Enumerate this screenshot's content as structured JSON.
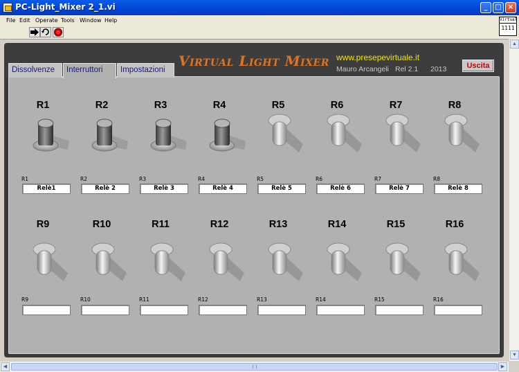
{
  "window": {
    "title": "PC-Light_Mixer 2_1.vi",
    "minimize": "_",
    "maximize": "□",
    "close": "×"
  },
  "menu": [
    "File",
    "Edit",
    "Operate",
    "Tools",
    "Window",
    "Help"
  ],
  "toolbar": {
    "run_icon": "run-arrow-icon",
    "continuous_icon": "run-continuous-icon",
    "abort_icon": "abort-icon"
  },
  "vi_icon_text": "Virtual\n1111",
  "tabs": [
    "Dissolvenze",
    "Interruttori",
    "Impostazioni"
  ],
  "active_tab": 1,
  "header": {
    "title": "Virtual Light Mixer",
    "url": "www.presepevirtuale.it",
    "author": "Mauro Arcangeli",
    "release": "Rel 2.1",
    "year": "2013",
    "exit_button": "Uscita"
  },
  "colors": {
    "title": "#e0731f",
    "url": "#f2e600",
    "exit": "#c8000f"
  },
  "switches": [
    {
      "label": "R1",
      "state": "on",
      "caption": "R1",
      "name": "Relè1"
    },
    {
      "label": "R2",
      "state": "on",
      "caption": "R2",
      "name": "Relè 2"
    },
    {
      "label": "R3",
      "state": "on",
      "caption": "R3",
      "name": "Relè 3"
    },
    {
      "label": "R4",
      "state": "on",
      "caption": "R4",
      "name": "Relè 4"
    },
    {
      "label": "R5",
      "state": "off",
      "caption": "R5",
      "name": "Relè 5"
    },
    {
      "label": "R6",
      "state": "off",
      "caption": "R6",
      "name": "Relè 6"
    },
    {
      "label": "R7",
      "state": "off",
      "caption": "R7",
      "name": "Relè 7"
    },
    {
      "label": "R8",
      "state": "off",
      "caption": "R8",
      "name": "Relè 8"
    },
    {
      "label": "R9",
      "state": "off",
      "caption": "R9",
      "name": ""
    },
    {
      "label": "R10",
      "state": "off",
      "caption": "R10",
      "name": ""
    },
    {
      "label": "R11",
      "state": "off",
      "caption": "R11",
      "name": ""
    },
    {
      "label": "R12",
      "state": "off",
      "caption": "R12",
      "name": ""
    },
    {
      "label": "R13",
      "state": "off",
      "caption": "R13",
      "name": ""
    },
    {
      "label": "R14",
      "state": "off",
      "caption": "R14",
      "name": ""
    },
    {
      "label": "R15",
      "state": "off",
      "caption": "R15",
      "name": ""
    },
    {
      "label": "R16",
      "state": "off",
      "caption": "R16",
      "name": ""
    }
  ]
}
